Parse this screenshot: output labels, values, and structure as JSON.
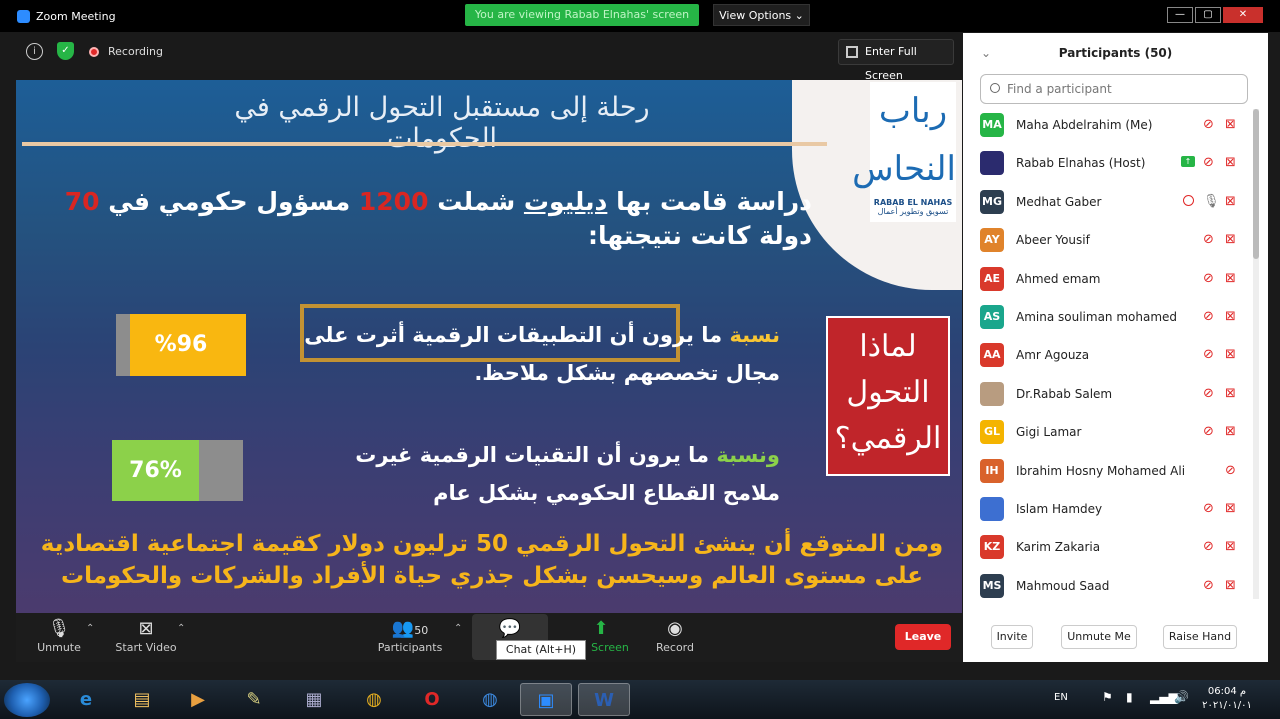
{
  "window": {
    "title": "Zoom Meeting",
    "viewing_banner": "You are viewing Rabab Elnahas' screen",
    "view_options": "View Options ⌄",
    "minimize": "—",
    "maximize": "▢",
    "close": "✕"
  },
  "meeting_bar": {
    "recording": "Recording",
    "full_screen": "Enter Full Screen"
  },
  "slide": {
    "title": "رحلة إلى مستقبل التحول الرقمي في الحكومات",
    "logo_ar": "رباب النحاس",
    "logo_en": "RABAB EL NAHAS",
    "logo_sub": "تسويق وتطوير أعمال",
    "intro_a": "دراسة قامت بها ",
    "intro_deloitte": "ديليوت",
    "intro_b": " شملت ",
    "intro_1200": "1200",
    "intro_c": " مسؤول حكومي في ",
    "intro_70": "70",
    "intro_d": " دولة كانت نتيجتها:",
    "why": "لماذا التحول الرقمي؟",
    "bar1_value": "%96",
    "bar2_value": "76%",
    "stat1_kw": "نسبة",
    "stat1_text": " ما يرون أن التطبيقات الرقمية أثرت على مجال تخصصهم بشكل ملاحظ.",
    "stat2_kw": "ونسبة",
    "stat2_text": " ما يرون أن التقنيات الرقمية غيرت ملامح القطاع الحكومي بشكل عام",
    "forecast": "ومن المتوقع أن ينشئ التحول الرقمي 50 ترليون دولار كقيمة اجتماعية اقتصادية على مستوى العالم وسيحسن بشكل جذري حياة الأفراد والشركات والحكومات"
  },
  "participants": {
    "header": "Participants (50)",
    "search_placeholder": "Find a participant",
    "items": [
      {
        "initials": "MA",
        "name": "Maha Abdelrahim (Me)",
        "color": "#26b546",
        "status": "muted"
      },
      {
        "initials": "",
        "name": "Rabab Elnahas (Host)",
        "color": "#2b2b6e",
        "status": "sharing"
      },
      {
        "initials": "MG",
        "name": "Medhat Gaber",
        "color": "#2d3e50",
        "status": "recording"
      },
      {
        "initials": "AY",
        "name": "Abeer Yousif",
        "color": "#e0832b",
        "status": "muted"
      },
      {
        "initials": "AE",
        "name": "Ahmed emam",
        "color": "#d9392b",
        "status": "muted"
      },
      {
        "initials": "AS",
        "name": "Amina souliman mohamed",
        "color": "#1aa68c",
        "status": "muted"
      },
      {
        "initials": "AA",
        "name": "Amr Agouza",
        "color": "#d9392b",
        "status": "muted"
      },
      {
        "initials": "",
        "name": "Dr.Rabab Salem",
        "color": "#b89c80",
        "status": "muted"
      },
      {
        "initials": "GL",
        "name": "Gigi Lamar",
        "color": "#f4b400",
        "status": "muted"
      },
      {
        "initials": "IH",
        "name": "Ibrahim Hosny Mohamed Ali",
        "color": "#d9622b",
        "status": "mic-only"
      },
      {
        "initials": "",
        "name": "Islam Hamdey",
        "color": "#3d6fd1",
        "status": "muted"
      },
      {
        "initials": "KZ",
        "name": "Karim Zakaria",
        "color": "#d9392b",
        "status": "muted"
      },
      {
        "initials": "MS",
        "name": "Mahmoud Saad",
        "color": "#2d3e50",
        "status": "muted"
      }
    ],
    "invite": "Invite",
    "unmute_me": "Unmute Me",
    "raise_hand": "Raise Hand"
  },
  "controls": {
    "unmute": "Unmute",
    "start_video": "Start Video",
    "participants": "Participants",
    "participants_count": "50",
    "chat": "Ch",
    "share_screen": "Screen",
    "record": "Record",
    "leave": "Leave",
    "chat_tooltip": "Chat (Alt+H)"
  },
  "taskbar": {
    "lang": "EN",
    "time": "06:04 م",
    "date": "٢٠٢١/٠١/٠١"
  }
}
